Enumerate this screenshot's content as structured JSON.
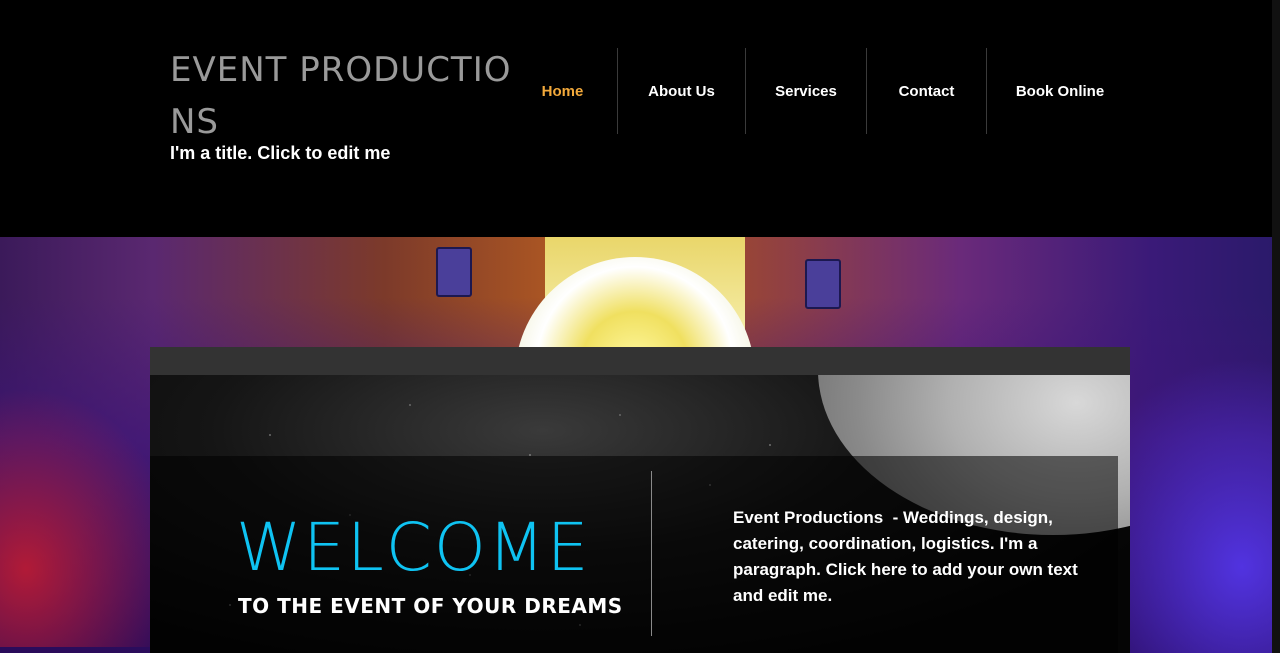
{
  "site": {
    "title": "EVENT PRODUCTIONS",
    "subtitle": "I'm a title. Click to edit me"
  },
  "nav": {
    "items": [
      {
        "label": "Home",
        "active": true
      },
      {
        "label": "About Us",
        "active": false
      },
      {
        "label": "Services",
        "active": false
      },
      {
        "label": "Contact",
        "active": false
      },
      {
        "label": "Book Online",
        "active": false
      }
    ]
  },
  "hero": {
    "welcome": "WELCOME",
    "tagline": "TO THE EVENT OF YOUR DREAMS",
    "paragraph": "Event Productions  - Weddings, design, catering, coordination, logistics. I'm a paragraph. Click here to add your own text and edit me."
  },
  "colors": {
    "accent_nav": "#f2a93b",
    "welcome": "#0fc3f2",
    "background": "#000000"
  }
}
